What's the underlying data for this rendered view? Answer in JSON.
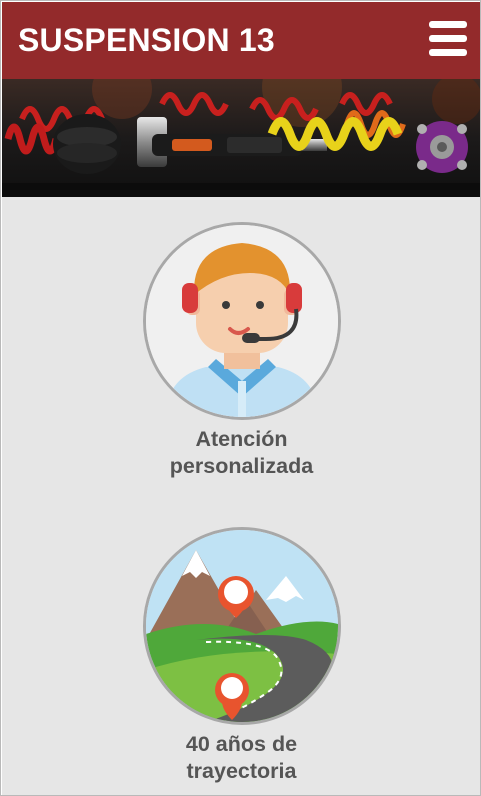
{
  "header": {
    "title": "SUSPENSION 13",
    "menu_icon": "hamburger-menu-icon",
    "background": "#932a2b"
  },
  "banner": {
    "description_icon": "coilover-suspension-banner"
  },
  "features": [
    {
      "icon": "customer-support-headset-icon",
      "label_line1": "Atención",
      "label_line2": "personalizada"
    },
    {
      "icon": "mountain-road-map-pin-icon",
      "label_line1": "40 años de",
      "label_line2": "trayectoria"
    }
  ]
}
